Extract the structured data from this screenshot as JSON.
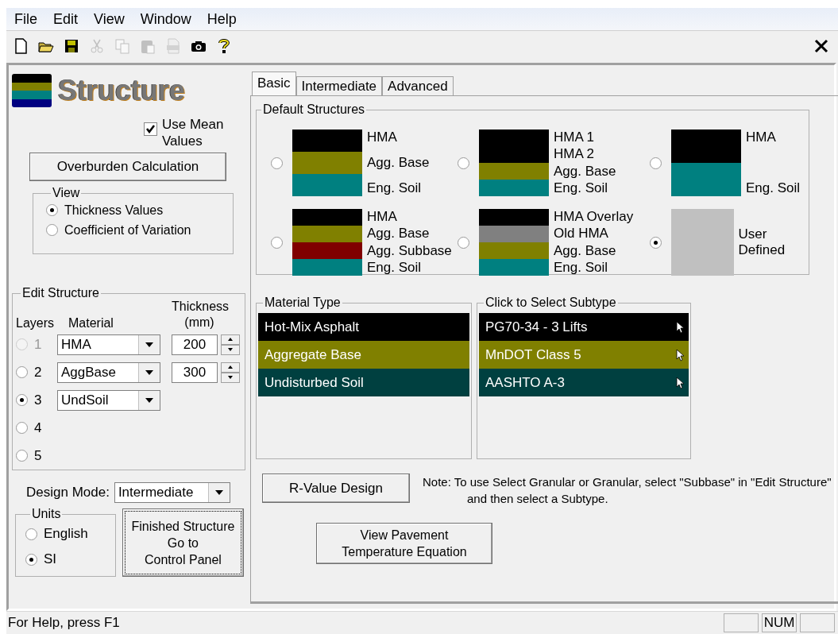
{
  "menu": [
    "File",
    "Edit",
    "View",
    "Window",
    "Help"
  ],
  "toolbar": [
    {
      "kind": "new",
      "disabled": false
    },
    {
      "kind": "open",
      "disabled": false
    },
    {
      "kind": "save",
      "disabled": false
    },
    {
      "kind": "cut",
      "disabled": true
    },
    {
      "kind": "copy",
      "disabled": true
    },
    {
      "kind": "paste",
      "disabled": true
    },
    {
      "kind": "pdf",
      "disabled": true
    },
    {
      "kind": "camera",
      "disabled": false
    },
    {
      "kind": "help",
      "disabled": false
    }
  ],
  "structure_title": "Structure",
  "use_mean_values": {
    "label": "Use Mean Values",
    "checked": true
  },
  "overburden_button": "Overburden Calculation",
  "view": {
    "title": "View",
    "options": [
      {
        "label": "Thickness Values",
        "selected": true
      },
      {
        "label": "Coefficient of Variation",
        "selected": false
      }
    ]
  },
  "edit_structure": {
    "title": "Edit Structure",
    "layers_header": "Layers",
    "material_header": "Material",
    "thickness_header": "Thickness (mm)",
    "rows": [
      {
        "number": "1",
        "selected": false,
        "disabled": true,
        "material": "HMA",
        "thickness": "200"
      },
      {
        "number": "2",
        "selected": false,
        "disabled": false,
        "material": "AggBase",
        "thickness": "300"
      },
      {
        "number": "3",
        "selected": true,
        "disabled": false,
        "material": "UndSoil"
      },
      {
        "number": "4",
        "selected": false,
        "disabled": false
      },
      {
        "number": "5",
        "selected": false,
        "disabled": false
      }
    ]
  },
  "design_mode": {
    "label": "Design Mode:",
    "value": "Intermediate"
  },
  "units": {
    "title": "Units",
    "options": [
      {
        "label": "English",
        "selected": false
      },
      {
        "label": "SI",
        "selected": true
      }
    ]
  },
  "finish_button": {
    "lines": [
      "Finished Structure",
      "Go to",
      "Control Panel"
    ],
    "focused": true
  },
  "tabs": [
    {
      "label": "Basic",
      "selected": true
    },
    {
      "label": "Intermediate",
      "selected": false
    },
    {
      "label": "Advanced",
      "selected": false
    }
  ],
  "default_structures": {
    "title": "Default Structures",
    "items": [
      {
        "selected": false,
        "layers": [
          {
            "label": "HMA",
            "color": "#000000"
          },
          {
            "label": "Agg. Base",
            "color": "#808000"
          },
          {
            "label": "Eng. Soil",
            "color": "#008080"
          }
        ]
      },
      {
        "selected": false,
        "layers": [
          {
            "label": "HMA 1",
            "color": "#000000"
          },
          {
            "label": "HMA 2",
            "color": "#000000"
          },
          {
            "label": "Agg. Base",
            "color": "#808000"
          },
          {
            "label": "Eng. Soil",
            "color": "#008080"
          }
        ]
      },
      {
        "selected": false,
        "layers": [
          {
            "label": "HMA",
            "color": "#000000"
          },
          {
            "label": "Eng. Soil",
            "color": "#008080"
          }
        ]
      },
      {
        "selected": false,
        "layers": [
          {
            "label": "HMA",
            "color": "#000000"
          },
          {
            "label": "Agg. Base",
            "color": "#808000"
          },
          {
            "label": "Agg. Subbase",
            "color": "#800000"
          },
          {
            "label": "Eng. Soil",
            "color": "#008080"
          }
        ]
      },
      {
        "selected": false,
        "layers": [
          {
            "label": "HMA Overlay",
            "color": "#000000"
          },
          {
            "label": "Old HMA",
            "color": "#808080"
          },
          {
            "label": "Agg. Base",
            "color": "#808000"
          },
          {
            "label": "Eng. Soil",
            "color": "#008080"
          }
        ]
      },
      {
        "selected": true,
        "layers": [
          {
            "label": "User Defined",
            "color": "#c0c0c0"
          }
        ]
      }
    ]
  },
  "material_type": {
    "title": "Material Type",
    "items": [
      {
        "label": "Hot-Mix Asphalt",
        "color": "#000000"
      },
      {
        "label": "Aggregate Base",
        "color": "#808000"
      },
      {
        "label": "Undisturbed Soil",
        "color": "#004040"
      }
    ]
  },
  "subtype": {
    "title": "Click to Select Subtype",
    "items": [
      {
        "label": "PG70-34 - 3 Lifts",
        "color": "#000000"
      },
      {
        "label": "MnDOT Class 5",
        "color": "#808000"
      },
      {
        "label": "AASHTO A-3",
        "color": "#004040"
      }
    ]
  },
  "r_value_button": "R-Value Design",
  "note": "Note: To use Select Granular or Granular, select \"Subbase\" in \"Edit Structure\" and then select a Subtype.",
  "view_pavement_button": "View Pavement Temperature Equation",
  "status_bar": {
    "text": "For Help, press F1",
    "indicators": [
      "NUM"
    ]
  }
}
